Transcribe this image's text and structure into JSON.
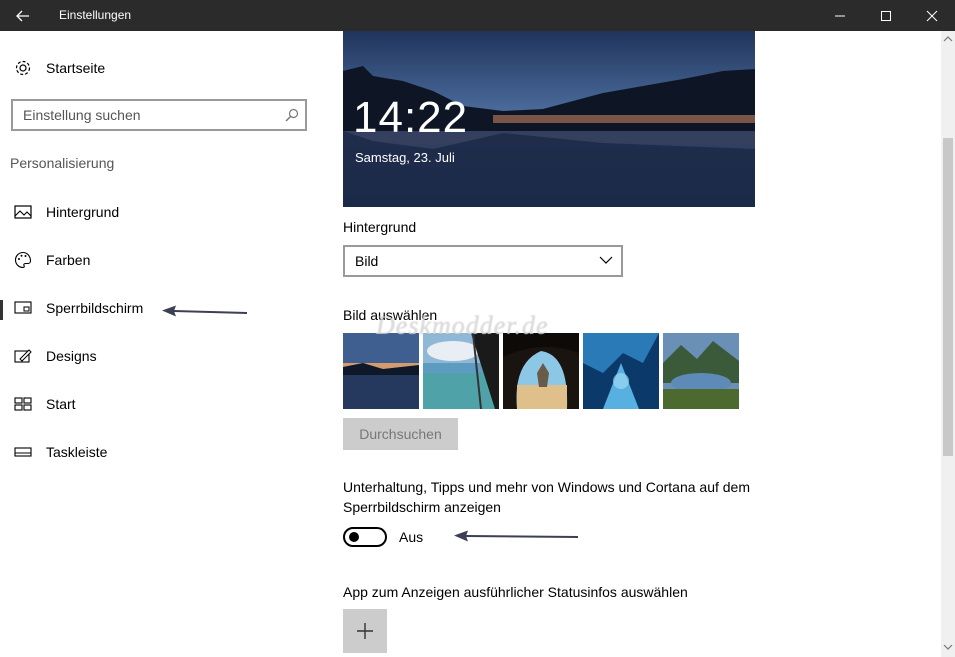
{
  "window": {
    "title": "Einstellungen"
  },
  "sidebar": {
    "home": "Startseite",
    "search_placeholder": "Einstellung suchen",
    "section": "Personalisierung",
    "items": [
      {
        "label": "Hintergrund",
        "icon": "picture-icon"
      },
      {
        "label": "Farben",
        "icon": "palette-icon"
      },
      {
        "label": "Sperrbildschirm",
        "icon": "lockscreen-icon",
        "active": true
      },
      {
        "label": "Designs",
        "icon": "themes-icon"
      },
      {
        "label": "Start",
        "icon": "start-icon"
      },
      {
        "label": "Taskleiste",
        "icon": "taskbar-icon"
      }
    ]
  },
  "main": {
    "preview": {
      "time": "14:22",
      "date": "Samstag, 23. Juli"
    },
    "background_label": "Hintergrund",
    "background_value": "Bild",
    "choose_picture_label": "Bild auswählen",
    "browse_label": "Durchsuchen",
    "tips_label_line1": "Unterhaltung, Tipps und mehr von Windows und Cortana auf dem",
    "tips_label_line2": "Sperrbildschirm anzeigen",
    "tips_toggle_state": "Aus",
    "status_app_label": "App zum Anzeigen ausführlicher Statusinfos auswählen",
    "watermark": "Deskmodder.de"
  },
  "colors": {
    "titlebar": "#2b2b2b",
    "button_gray": "#cccccc",
    "annotation_arrow": "#3c3f55"
  }
}
